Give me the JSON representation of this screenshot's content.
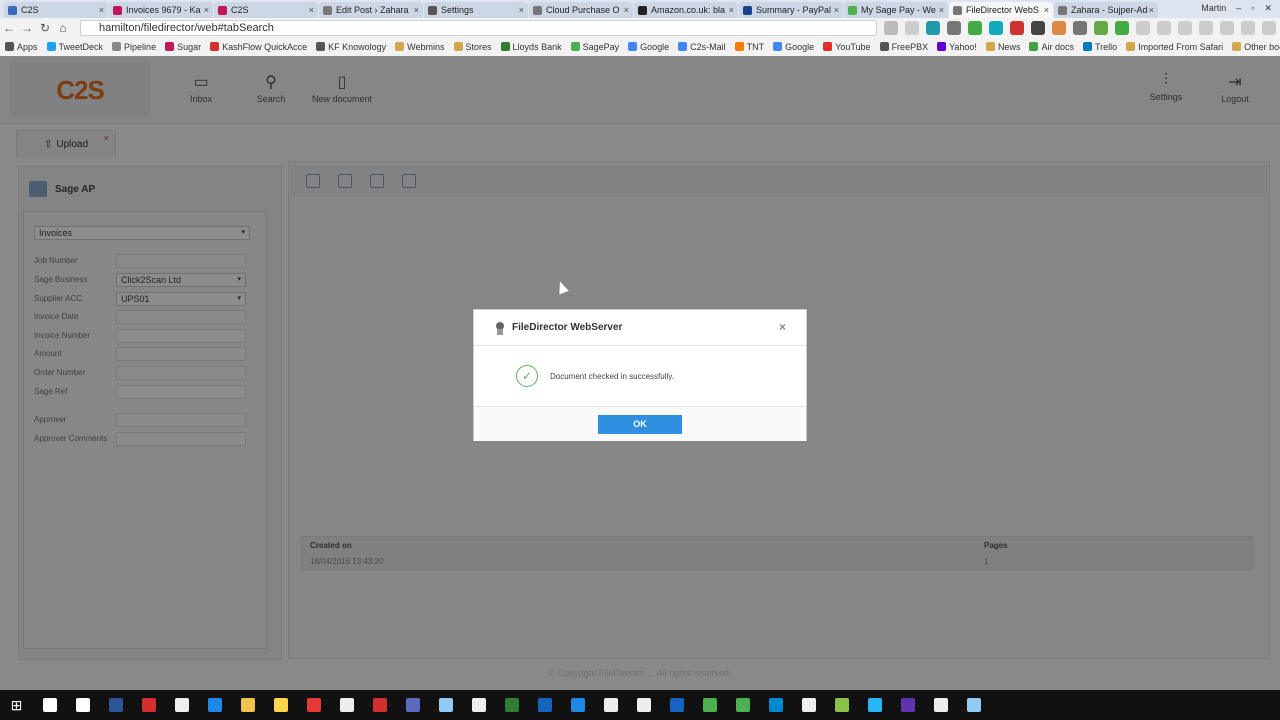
{
  "browser": {
    "tabs": [
      {
        "title": "C2S",
        "color": "#3b6bbf"
      },
      {
        "title": "Invoices 9679 - Ka",
        "color": "#c2185b"
      },
      {
        "title": "C2S",
        "color": "#c2185b"
      },
      {
        "title": "Edit Post › Zahara",
        "color": "#777"
      },
      {
        "title": "Settings",
        "color": "#555"
      },
      {
        "title": "Cloud Purchase O",
        "color": "#777"
      },
      {
        "title": "Amazon.co.uk: bla",
        "color": "#222"
      },
      {
        "title": "Summary - PayPal",
        "color": "#1b3f91"
      },
      {
        "title": "My Sage Pay - We",
        "color": "#4caf50"
      },
      {
        "title": "FileDirector WebS",
        "color": "#777",
        "active": true
      },
      {
        "title": "Zahara - Sujper-Ad",
        "color": "#777"
      }
    ],
    "close_glyph": "×",
    "user": "Martin",
    "url": "hamilton/filedirector/web#tabSearch",
    "bookmarks": [
      {
        "label": "Apps",
        "color": "#555"
      },
      {
        "label": "TweetDeck",
        "color": "#1da1f2"
      },
      {
        "label": "Pipeline",
        "color": "#888"
      },
      {
        "label": "Sugar",
        "color": "#c2185b"
      },
      {
        "label": "KashFlow QuickAcce",
        "color": "#d32f2f"
      },
      {
        "label": "KF Knowology",
        "color": "#555"
      },
      {
        "label": "Webmins",
        "color": "#d4a84a"
      },
      {
        "label": "Stores",
        "color": "#d4a84a"
      },
      {
        "label": "Lloyds Bank",
        "color": "#2e7d32"
      },
      {
        "label": "SagePay",
        "color": "#4caf50"
      },
      {
        "label": "Google",
        "color": "#4285f4"
      },
      {
        "label": "C2s-Mail",
        "color": "#4285f4"
      },
      {
        "label": "TNT",
        "color": "#f57c00"
      },
      {
        "label": "Google",
        "color": "#4285f4"
      },
      {
        "label": "YouTube",
        "color": "#e52d27"
      },
      {
        "label": "FreePBX",
        "color": "#555"
      },
      {
        "label": "Yahoo!",
        "color": "#6001d2"
      },
      {
        "label": "News",
        "color": "#d4a84a"
      },
      {
        "label": "Air docs",
        "color": "#43a047"
      },
      {
        "label": "Trello",
        "color": "#0079bf"
      },
      {
        "label": "Imported From Safari",
        "color": "#d4a84a"
      },
      {
        "label": "Other bookmarks",
        "color": "#d4a84a"
      }
    ]
  },
  "app": {
    "logo": "C2S",
    "nav": [
      {
        "label": "Inbox",
        "icon": "inbox-icon",
        "glyph": "▭"
      },
      {
        "label": "Search",
        "icon": "search-icon",
        "glyph": "⚲"
      },
      {
        "label": "New document",
        "icon": "new-document-icon",
        "glyph": "▯"
      },
      {
        "label": "Settings",
        "icon": "settings-icon",
        "glyph": "⫶"
      },
      {
        "label": "Logout",
        "icon": "logout-icon",
        "glyph": "⇥"
      }
    ],
    "upload_tab": "Upload",
    "upload_glyph": "⇧",
    "close_glyph": "×",
    "dropdown_glyph": "▾",
    "panel_title": "Sage AP",
    "doc_type": "Invoices",
    "fields": [
      {
        "label": "Job Number",
        "value": ""
      },
      {
        "label": "Sage Business",
        "value": "Click2Scan Ltd",
        "select": true
      },
      {
        "label": "Supplier ACC",
        "value": "UPS01",
        "select": true
      },
      {
        "label": "Invoice Date",
        "value": ""
      },
      {
        "label": "Invoice Number",
        "value": ""
      },
      {
        "label": "Amount",
        "value": ""
      },
      {
        "label": "Order Number",
        "value": ""
      },
      {
        "label": "Sage Ref",
        "value": ""
      },
      {
        "label": "Approver",
        "value": ""
      },
      {
        "label": "Approver Comments",
        "value": ""
      }
    ],
    "table": {
      "headers": [
        "Created on",
        "Pages"
      ],
      "rows": [
        [
          "18/04/2016 13:43:20",
          "1"
        ]
      ]
    },
    "footer": "© Copyright FileDirector ... All rights reserved."
  },
  "dialog": {
    "title": "FileDirector WebServer",
    "message": "Document checked in successfully.",
    "ok": "OK",
    "close_glyph": "×",
    "check_glyph": "✓"
  },
  "taskbar": {
    "start_glyph": "⊞",
    "icons": [
      "#fff",
      "#fff",
      "#2b5797",
      "#d32f2f",
      "#eee",
      "#1e88e5",
      "#f2c14e",
      "#ffd54f",
      "#e53935",
      "#eee",
      "#d32f2f",
      "#5c6bc0",
      "#90caf9",
      "#eee",
      "#2e7d32",
      "#1565c0",
      "#1e88e5",
      "#eee",
      "#eee",
      "#1565c0",
      "#4caf50",
      "#4caf50",
      "#0288d1",
      "#eee",
      "#8bc34a",
      "#29b6f6",
      "#5e35b1",
      "#eee",
      "#90caf9"
    ]
  }
}
